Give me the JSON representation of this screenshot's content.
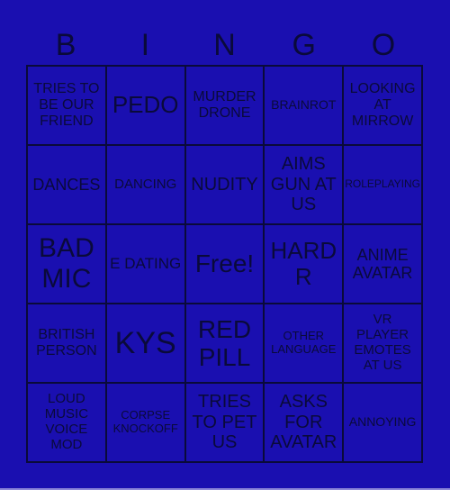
{
  "header": {
    "letters": [
      "B",
      "I",
      "N",
      "G",
      "O"
    ]
  },
  "board": {
    "cells": [
      "TRIES TO BE OUR FRIEND",
      "PEDO",
      "MURDER DRONE",
      "BRAINROT",
      "LOOKING AT MIRROW",
      "DANCES",
      "DANCING",
      "NUDITY",
      "AIMS GUN AT US",
      "ROLEPLAYING",
      "BAD MIC",
      "E DATING",
      "Free!",
      "HARD R",
      "ANIME AVATAR",
      "BRITISH PERSON",
      "KYS",
      "RED PILL",
      "OTHER LANGUAGE",
      "VR PLAYER EMOTES AT US",
      "LOUD MUSIC VOICE MOD",
      "CORPSE KNOCKOFF",
      "TRIES TO PET US",
      "ASKS FOR AVATAR",
      "ANNOYING"
    ]
  },
  "colors": {
    "background": "#1a0fb0",
    "text": "#0a0a3a",
    "grid_lines": "#0a0a3a"
  }
}
